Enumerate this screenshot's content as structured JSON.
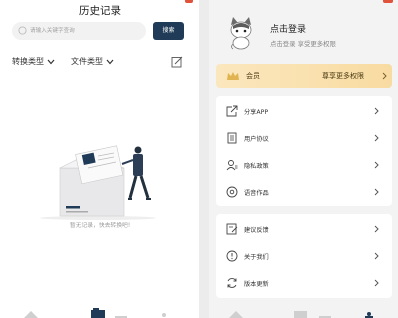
{
  "history": {
    "title": "历史记录",
    "search": {
      "placeholder": "请输入关键字查询",
      "button_label": "搜索"
    },
    "filters": [
      {
        "label": "转换类型"
      },
      {
        "label": "文件类型"
      }
    ],
    "empty_text": "暂无记录，快去转换吧!"
  },
  "profile": {
    "login_title": "点击登录",
    "login_subtitle": "点击登录 享受更多权限",
    "vip": {
      "label": "会员",
      "right_label": "尊享更多权限"
    },
    "menu_group_1": [
      {
        "label": "分享APP",
        "icon": "share-icon"
      },
      {
        "label": "用户协议",
        "icon": "document-icon"
      },
      {
        "label": "隐私政策",
        "icon": "user-privacy-icon"
      },
      {
        "label": "语音作品",
        "icon": "audio-works-icon"
      }
    ],
    "menu_group_2": [
      {
        "label": "建议反馈",
        "icon": "feedback-icon"
      },
      {
        "label": "关于我们",
        "icon": "info-icon"
      },
      {
        "label": "版本更新",
        "icon": "refresh-icon"
      }
    ]
  },
  "colors": {
    "accent": "#1f3b57",
    "vip_gold": "#f8dba1",
    "badge_red": "#e0523a"
  }
}
